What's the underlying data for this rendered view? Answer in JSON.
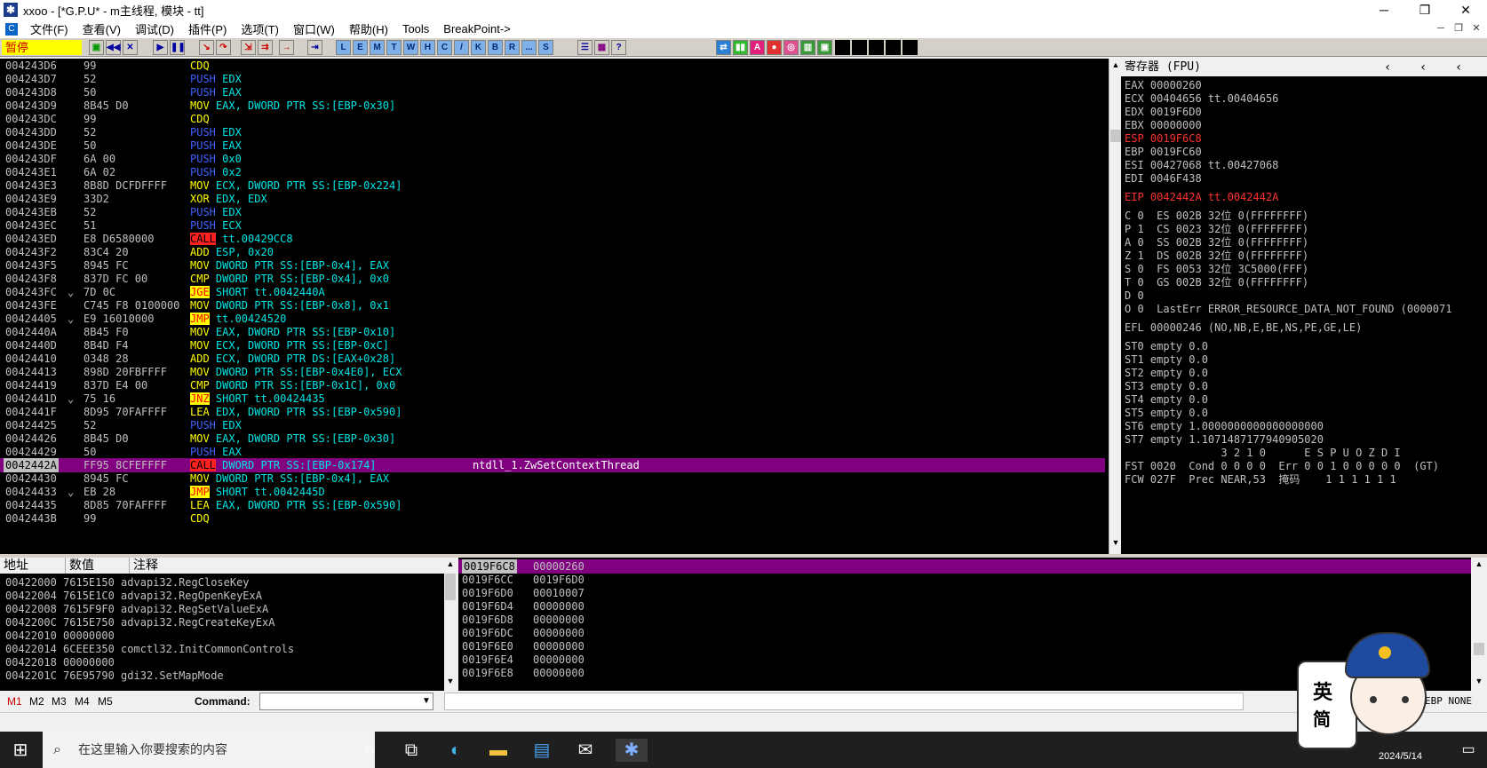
{
  "window": {
    "title": "xxoo - [*G.P.U* - m主线程, 模块 - tt]"
  },
  "menu": [
    "文件(F)",
    "查看(V)",
    "调试(D)",
    "插件(P)",
    "选项(T)",
    "窗口(W)",
    "帮助(H)",
    "Tools",
    "BreakPoint->"
  ],
  "toolbar": {
    "status": "暂停",
    "letter_buttons": [
      "L",
      "E",
      "M",
      "T",
      "W",
      "H",
      "C",
      "/",
      "K",
      "B",
      "R",
      "...",
      "S"
    ]
  },
  "disasm": [
    {
      "addr": "004243D6",
      "hex": "99",
      "asm": "CDQ",
      "comment": ""
    },
    {
      "addr": "004243D7",
      "hex": "52",
      "asm": "PUSH EDX",
      "comment": ""
    },
    {
      "addr": "004243D8",
      "hex": "50",
      "asm": "PUSH EAX",
      "comment": ""
    },
    {
      "addr": "004243D9",
      "hex": "8B45 D0",
      "asm": "MOV EAX, DWORD PTR SS:[EBP-0x30]",
      "comment": ""
    },
    {
      "addr": "004243DC",
      "hex": "99",
      "asm": "CDQ",
      "comment": ""
    },
    {
      "addr": "004243DD",
      "hex": "52",
      "asm": "PUSH EDX",
      "comment": ""
    },
    {
      "addr": "004243DE",
      "hex": "50",
      "asm": "PUSH EAX",
      "comment": ""
    },
    {
      "addr": "004243DF",
      "hex": "6A 00",
      "asm": "PUSH 0x0",
      "comment": ""
    },
    {
      "addr": "004243E1",
      "hex": "6A 02",
      "asm": "PUSH 0x2",
      "comment": ""
    },
    {
      "addr": "004243E3",
      "hex": "8B8D DCFDFFFF",
      "asm": "MOV ECX, DWORD PTR SS:[EBP-0x224]",
      "comment": ""
    },
    {
      "addr": "004243E9",
      "hex": "33D2",
      "asm": "XOR EDX, EDX",
      "comment": ""
    },
    {
      "addr": "004243EB",
      "hex": "52",
      "asm": "PUSH EDX",
      "comment": ""
    },
    {
      "addr": "004243EC",
      "hex": "51",
      "asm": "PUSH ECX",
      "comment": ""
    },
    {
      "addr": "004243ED",
      "hex": "E8 D6580000",
      "asm": "CALL tt.00429CC8",
      "comment": ""
    },
    {
      "addr": "004243F2",
      "hex": "83C4 20",
      "asm": "ADD ESP, 0x20",
      "comment": ""
    },
    {
      "addr": "004243F5",
      "hex": "8945 FC",
      "asm": "MOV DWORD PTR SS:[EBP-0x4], EAX",
      "comment": ""
    },
    {
      "addr": "004243F8",
      "hex": "837D FC 00",
      "asm": "CMP DWORD PTR SS:[EBP-0x4], 0x0",
      "comment": ""
    },
    {
      "addr": "004243FC",
      "hex": "7D 0C",
      "asm": "JGE SHORT tt.0042440A",
      "comment": ""
    },
    {
      "addr": "004243FE",
      "hex": "C745 F8 0100000",
      "asm": "MOV DWORD PTR SS:[EBP-0x8], 0x1",
      "comment": ""
    },
    {
      "addr": "00424405",
      "hex": "E9 16010000",
      "asm": "JMP tt.00424520",
      "comment": ""
    },
    {
      "addr": "0042440A",
      "hex": "8B45 F0",
      "asm": "MOV EAX, DWORD PTR SS:[EBP-0x10]",
      "comment": ""
    },
    {
      "addr": "0042440D",
      "hex": "8B4D F4",
      "asm": "MOV ECX, DWORD PTR SS:[EBP-0xC]",
      "comment": ""
    },
    {
      "addr": "00424410",
      "hex": "0348 28",
      "asm": "ADD ECX, DWORD PTR DS:[EAX+0x28]",
      "comment": ""
    },
    {
      "addr": "00424413",
      "hex": "898D 20FBFFFF",
      "asm": "MOV DWORD PTR SS:[EBP-0x4E0], ECX",
      "comment": ""
    },
    {
      "addr": "00424419",
      "hex": "837D E4 00",
      "asm": "CMP DWORD PTR SS:[EBP-0x1C], 0x0",
      "comment": ""
    },
    {
      "addr": "0042441D",
      "hex": "75 16",
      "asm": "JNZ SHORT tt.00424435",
      "comment": ""
    },
    {
      "addr": "0042441F",
      "hex": "8D95 70FAFFFF",
      "asm": "LEA EDX, DWORD PTR SS:[EBP-0x590]",
      "comment": ""
    },
    {
      "addr": "00424425",
      "hex": "52",
      "asm": "PUSH EDX",
      "comment": ""
    },
    {
      "addr": "00424426",
      "hex": "8B45 D0",
      "asm": "MOV EAX, DWORD PTR SS:[EBP-0x30]",
      "comment": ""
    },
    {
      "addr": "00424429",
      "hex": "50",
      "asm": "PUSH EAX",
      "comment": ""
    },
    {
      "addr": "0042442A",
      "hex": "FF95 8CFEFFFF",
      "asm": "CALL DWORD PTR SS:[EBP-0x174]",
      "comment": "ntdll_1.ZwSetContextThread"
    },
    {
      "addr": "00424430",
      "hex": "8945 FC",
      "asm": "MOV DWORD PTR SS:[EBP-0x4], EAX",
      "comment": ""
    },
    {
      "addr": "00424433",
      "hex": "EB 28",
      "asm": "JMP SHORT tt.0042445D",
      "comment": ""
    },
    {
      "addr": "00424435",
      "hex": "8D85 70FAFFFF",
      "asm": "LEA EAX, DWORD PTR SS:[EBP-0x590]",
      "comment": ""
    },
    {
      "addr": "0042443B",
      "hex": "99",
      "asm": "CDQ",
      "comment": ""
    }
  ],
  "registers": {
    "header": "寄存器 (FPU)",
    "lines": [
      "EAX 00000260",
      "ECX 00404656 tt.00404656",
      "EDX 0019F6D0",
      "EBX 00000000",
      "ESP 0019F6C8",
      "EBP 0019FC60",
      "ESI 00427068 tt.00427068",
      "EDI 0046F438",
      "",
      "EIP 0042442A tt.0042442A",
      "",
      "C 0  ES 002B 32位 0(FFFFFFFF)",
      "P 1  CS 0023 32位 0(FFFFFFFF)",
      "A 0  SS 002B 32位 0(FFFFFFFF)",
      "Z 1  DS 002B 32位 0(FFFFFFFF)",
      "S 0  FS 0053 32位 3C5000(FFF)",
      "T 0  GS 002B 32位 0(FFFFFFFF)",
      "D 0",
      "O 0  LastErr ERROR_RESOURCE_DATA_NOT_FOUND (0000071",
      "",
      "EFL 00000246 (NO,NB,E,BE,NS,PE,GE,LE)",
      "",
      "ST0 empty 0.0",
      "ST1 empty 0.0",
      "ST2 empty 0.0",
      "ST3 empty 0.0",
      "ST4 empty 0.0",
      "ST5 empty 0.0",
      "ST6 empty 1.0000000000000000000",
      "ST7 empty 1.1071487177940905020",
      "               3 2 1 0      E S P U O Z D I",
      "FST 0020  Cond 0 0 0 0  Err 0 0 1 0 0 0 0 0  (GT)",
      "FCW 027F  Prec NEAR,53  掩码    1 1 1 1 1 1"
    ]
  },
  "dump": {
    "headers": [
      "地址",
      "数值",
      "注释"
    ],
    "rows": [
      "00422000 7615E150 advapi32.RegCloseKey",
      "00422004 7615E1C0 advapi32.RegOpenKeyExA",
      "00422008 7615F9F0 advapi32.RegSetValueExA",
      "0042200C 7615E750 advapi32.RegCreateKeyExA",
      "00422010 00000000",
      "00422014 6CEEE350 comctl32.InitCommonControls",
      "00422018 00000000",
      "0042201C 76E95790 gdi32.SetMapMode"
    ]
  },
  "stack": [
    {
      "addr": "0019F6C8",
      "val": "00000260"
    },
    {
      "addr": "0019F6CC",
      "val": "0019F6D0"
    },
    {
      "addr": "0019F6D0",
      "val": "00010007"
    },
    {
      "addr": "0019F6D4",
      "val": "00000000"
    },
    {
      "addr": "0019F6D8",
      "val": "00000000"
    },
    {
      "addr": "0019F6DC",
      "val": "00000000"
    },
    {
      "addr": "0019F6E0",
      "val": "00000000"
    },
    {
      "addr": "0019F6E4",
      "val": "00000000"
    },
    {
      "addr": "0019F6E8",
      "val": "00000000"
    }
  ],
  "cmdbar": {
    "tabs": [
      "M1",
      "M2",
      "M3",
      "M4",
      "M5"
    ],
    "command_label": "Command:",
    "right_text": "EBP  NONE"
  },
  "taskbar": {
    "search_placeholder": "在这里输入你要搜索的内容",
    "ime": [
      "英",
      "简"
    ],
    "clock": "2024/5/14"
  }
}
